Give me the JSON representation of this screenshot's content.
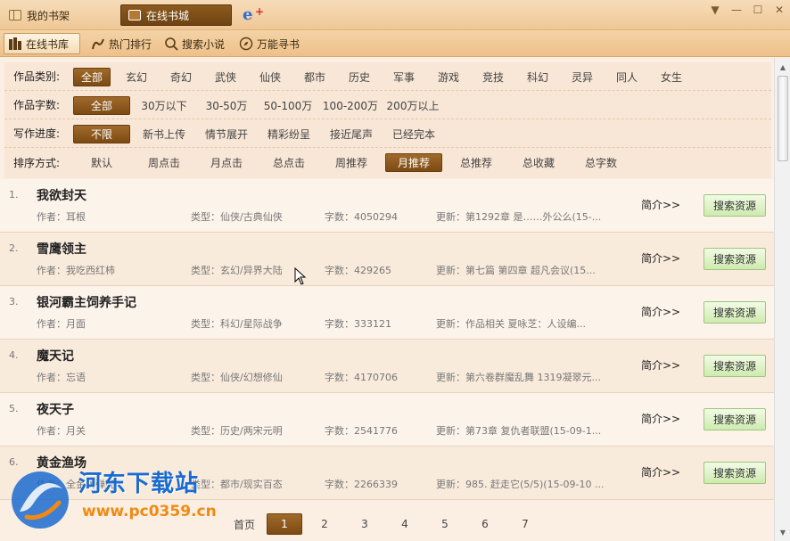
{
  "window": {
    "tabs": [
      {
        "label": "我的书架"
      },
      {
        "label": "在线书城"
      }
    ],
    "controls": {
      "dropdown": "▼",
      "minimize": "—",
      "maximize": "☐",
      "close": "✕"
    }
  },
  "toolbar": {
    "items": [
      {
        "label": "在线书库",
        "icon": "books-icon"
      },
      {
        "label": "热门排行",
        "icon": "ranking-icon"
      },
      {
        "label": "搜索小说",
        "icon": "search-icon"
      },
      {
        "label": "万能寻书",
        "icon": "compass-icon"
      }
    ]
  },
  "filters": {
    "category": {
      "label": "作品类别:",
      "options": [
        "全部",
        "玄幻",
        "奇幻",
        "武侠",
        "仙侠",
        "都市",
        "历史",
        "军事",
        "游戏",
        "竞技",
        "科幻",
        "灵异",
        "同人",
        "女生"
      ],
      "selected": "全部"
    },
    "words": {
      "label": "作品字数:",
      "options": [
        "全部",
        "30万以下",
        "30-50万",
        "50-100万",
        "100-200万",
        "200万以上"
      ],
      "selected": "全部"
    },
    "progress": {
      "label": "写作进度:",
      "options": [
        "不限",
        "新书上传",
        "情节展开",
        "精彩纷呈",
        "接近尾声",
        "已经完本"
      ],
      "selected": "不限"
    },
    "sort": {
      "label": "排序方式:",
      "options": [
        "默认",
        "周点击",
        "月点击",
        "总点击",
        "周推荐",
        "月推荐",
        "总推荐",
        "总收藏",
        "总字数"
      ],
      "selected": "月推荐"
    }
  },
  "books": [
    {
      "index": "1.",
      "title": "我欲封天",
      "author": "作者：耳根",
      "type": "类型：仙侠/古典仙侠",
      "words": "字数：4050294",
      "update": "更新：第1292章 是……外公么(15-...",
      "intro": "简介>>",
      "search": "搜索资源"
    },
    {
      "index": "2.",
      "title": "雪鹰领主",
      "author": "作者：我吃西红柿",
      "type": "类型：玄幻/异界大陆",
      "words": "字数：429265",
      "update": "更新：第七篇 第四章 超凡会议(15...",
      "intro": "简介>>",
      "search": "搜索资源"
    },
    {
      "index": "3.",
      "title": "银河霸主饲养手记",
      "author": "作者：月面",
      "type": "类型：科幻/星际战争",
      "words": "字数：333121",
      "update": "更新：作品相关 夏咏芝：人设编...",
      "intro": "简介>>",
      "search": "搜索资源"
    },
    {
      "index": "4.",
      "title": "魔天记",
      "author": "作者：忘语",
      "type": "类型：仙侠/幻想修仙",
      "words": "字数：4170706",
      "update": "更新：第六卷群魔乱舞 1319凝翠元...",
      "intro": "简介>>",
      "search": "搜索资源"
    },
    {
      "index": "5.",
      "title": "夜天子",
      "author": "作者：月关",
      "type": "类型：历史/两宋元明",
      "words": "字数：2541776",
      "update": "更新：第73章 复仇者联盟(15-09-1...",
      "intro": "简介>>",
      "search": "搜索资源"
    },
    {
      "index": "6.",
      "title": "黄金渔场",
      "author": "作者：全金属弹壳",
      "type": "类型：都市/现实百态",
      "words": "字数：2266339",
      "update": "更新：985. 赶走它(5/5)(15-09-10 ...",
      "intro": "简介>>",
      "search": "搜索资源"
    }
  ],
  "pager": {
    "first": "首页",
    "pages": [
      "1",
      "2",
      "3",
      "4",
      "5",
      "6",
      "7"
    ],
    "current": "1"
  },
  "watermark": {
    "title": "河东下载站",
    "url": "www.pc0359.cn"
  },
  "colors": {
    "accent_brown": "#7c4a14",
    "search_button": "#cfeab0",
    "watermark_blue": "#1a6bd0",
    "watermark_orange": "#f08a14"
  }
}
